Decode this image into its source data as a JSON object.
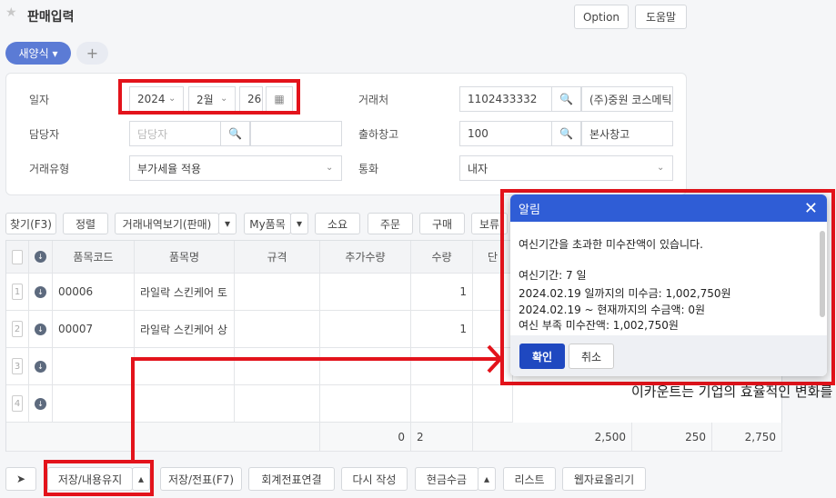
{
  "header": {
    "title": "판매입력",
    "option_label": "Option",
    "help_label": "도움말"
  },
  "tabs": {
    "new_form_label": "새양식",
    "add_label": "+"
  },
  "form": {
    "date_label": "일자",
    "year": "2024",
    "month": "2월",
    "day": "26",
    "manager_label": "담당자",
    "manager_placeholder": "담당자",
    "trade_type_label": "거래유형",
    "trade_type_value": "부가세율 적용",
    "client_label": "거래처",
    "client_code": "1102433332",
    "client_name": "(주)중원 코스메틱",
    "warehouse_label": "출하창고",
    "warehouse_code": "100",
    "warehouse_name": "본사창고",
    "currency_label": "통화",
    "currency_value": "내자"
  },
  "toolbar": {
    "find": "찾기(F3)",
    "sort": "정렬",
    "history": "거래내역보기(판매)",
    "myitem": "My품목",
    "consume": "소요",
    "order": "주문",
    "purchase": "구매",
    "more": "보류"
  },
  "table": {
    "headers": [
      "품목코드",
      "품목명",
      "규격",
      "추가수량",
      "수량",
      "단"
    ],
    "rows": [
      {
        "num": "1",
        "code": "00006",
        "name": "라일락 스킨케어 토",
        "qty": "1"
      },
      {
        "num": "2",
        "code": "00007",
        "name": "라일락 스킨케어 상",
        "qty": "1"
      },
      {
        "num": "3",
        "code": "",
        "name": "",
        "qty": ""
      },
      {
        "num": "4",
        "code": "",
        "name": "",
        "qty": ""
      }
    ],
    "footer": {
      "extra_qty": "0",
      "qty": "2",
      "supply": "2,500",
      "vat": "250",
      "total": "2,750"
    }
  },
  "background_text": "이카운트는 기업의 효율적인 변화를",
  "bottom": {
    "save_keep": "저장/내용유지",
    "save_slip": "저장/전표(F7)",
    "link_slip": "회계전표연결",
    "rewrite": "다시 작성",
    "cash": "현금수금",
    "list": "리스트",
    "web_upload": "웹자료올리기"
  },
  "modal": {
    "title": "알림",
    "line1": "여신기간을 초과한 미수잔액이 있습니다.",
    "line2": "여신기간: 7 일",
    "line3": "2024.02.19 일까지의 미수금: 1,002,750원",
    "line4": "2024.02.19 ~ 현재까지의 수금액: 0원",
    "line5": "여신 부족 미수잔액: 1,002,750원",
    "confirm": "확인",
    "cancel": "취소"
  }
}
